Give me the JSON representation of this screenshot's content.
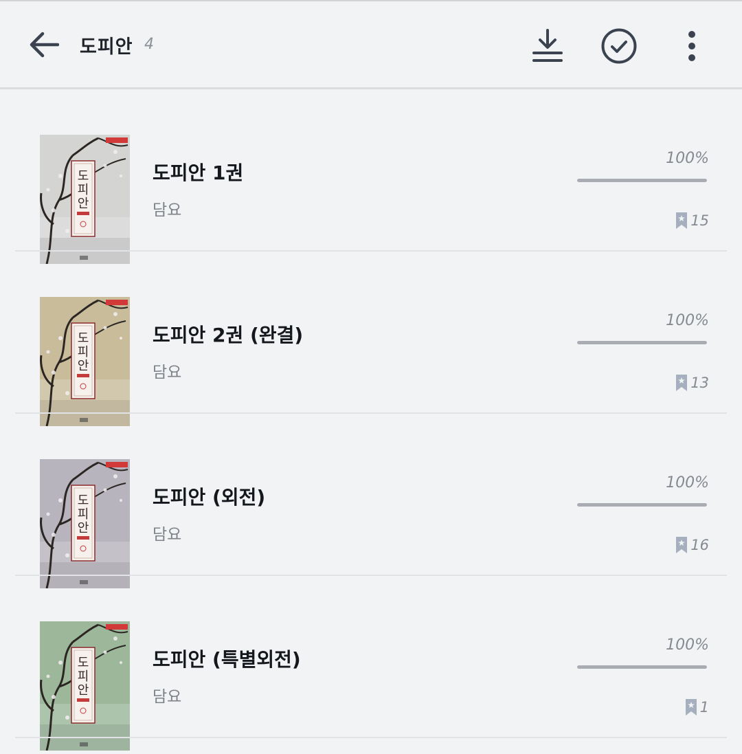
{
  "header": {
    "title": "도피안",
    "count": "4",
    "icons": {
      "back": "arrow-left-icon",
      "download": "download-icon",
      "select": "check-circle-icon",
      "more": "more-vertical-icon"
    }
  },
  "books": [
    {
      "title": "도피안 1권",
      "author": "담요",
      "percent": "100%",
      "progress": 1.0,
      "bookmarks": "15",
      "cover_color": "#d4d5d3"
    },
    {
      "title": "도피안 2권 (완결)",
      "author": "담요",
      "percent": "100%",
      "progress": 1.0,
      "bookmarks": "13",
      "cover_color": "#c9bc9b"
    },
    {
      "title": "도피안 (외전)",
      "author": "담요",
      "percent": "100%",
      "progress": 1.0,
      "bookmarks": "16",
      "cover_color": "#b8b4bd"
    },
    {
      "title": "도피안 (특별외전)",
      "author": "담요",
      "percent": "100%",
      "progress": 1.0,
      "bookmarks": "1",
      "cover_color": "#9cb79a"
    }
  ],
  "colors": {
    "background": "#f2f3f5",
    "icon": "#3b4350",
    "bookmark": "#a6afbd"
  }
}
